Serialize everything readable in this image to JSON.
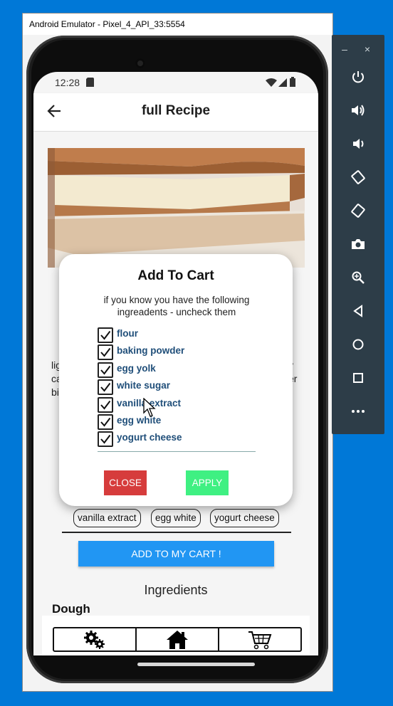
{
  "window": {
    "title": "Android Emulator - Pixel_4_API_33:5554"
  },
  "toolbar": {
    "minimize": "–",
    "close": "×"
  },
  "status": {
    "time": "12:28"
  },
  "appbar": {
    "title": "full Recipe"
  },
  "description": {
    "left_fragments": [
      "lig",
      "ca",
      "bi"
    ],
    "right_fragments": [
      "y",
      "er"
    ]
  },
  "chips": [
    "vanilla extract",
    "egg white",
    "yogurt cheese"
  ],
  "cart_button": {
    "label": "ADD TO MY CART !"
  },
  "ingredients": {
    "title": "Ingredients",
    "section": "Dough"
  },
  "dialog": {
    "title": "Add To Cart",
    "subtitle": "if you know you have the following ingreadents - uncheck them",
    "items": [
      {
        "label": "flour",
        "checked": true
      },
      {
        "label": "baking powder",
        "checked": true
      },
      {
        "label": "egg yolk",
        "checked": true
      },
      {
        "label": "white sugar",
        "checked": true
      },
      {
        "label": "vanilla extract",
        "checked": true
      },
      {
        "label": "egg white",
        "checked": true
      },
      {
        "label": "yogurt cheese",
        "checked": true
      }
    ],
    "close_label": "CLOSE",
    "apply_label": "APPLY"
  },
  "colors": {
    "close_button": "#d63c3c",
    "apply_button": "#3ff082",
    "cart_button": "#2196f3",
    "checkbox_label": "#1f4e79"
  }
}
